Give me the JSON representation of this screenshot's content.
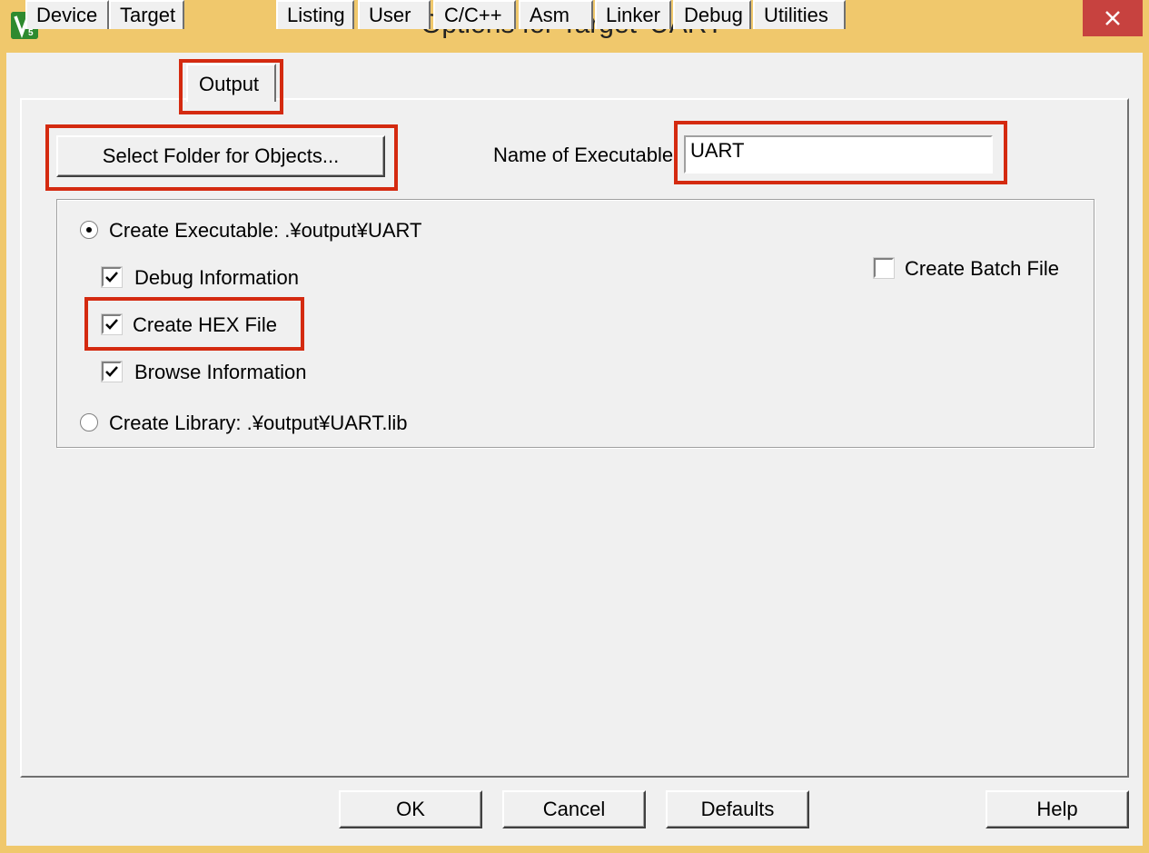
{
  "window": {
    "title": "Options for Target 'UART'",
    "icon": "keil-uvision-icon"
  },
  "tabs": [
    {
      "label": "Device"
    },
    {
      "label": "Target"
    },
    {
      "label": "Output",
      "active": true
    },
    {
      "label": "Listing"
    },
    {
      "label": "User"
    },
    {
      "label": "C/C++"
    },
    {
      "label": "Asm"
    },
    {
      "label": "Linker"
    },
    {
      "label": "Debug"
    },
    {
      "label": "Utilities"
    }
  ],
  "output": {
    "select_folder_label": "Select Folder for Objects...",
    "name_of_executable_label": "Name of Executable:",
    "name_of_executable_value": "UART",
    "create_executable_label": "Create Executable:  .¥output¥UART",
    "create_executable_selected": true,
    "debug_information_label": "Debug Information",
    "debug_information_checked": true,
    "create_hex_label": "Create HEX File",
    "create_hex_checked": true,
    "browse_information_label": "Browse Information",
    "browse_information_checked": true,
    "create_library_label": "Create Library:  .¥output¥UART.lib",
    "create_library_selected": false,
    "create_batch_label": "Create Batch File",
    "create_batch_checked": false
  },
  "footer": {
    "ok_label": "OK",
    "cancel_label": "Cancel",
    "defaults_label": "Defaults",
    "help_label": "Help"
  },
  "colors": {
    "title_bar": "#f0c86c",
    "close_button": "#c7423f",
    "highlight": "#d42a10",
    "dialog_bg": "#f0f0f0"
  }
}
